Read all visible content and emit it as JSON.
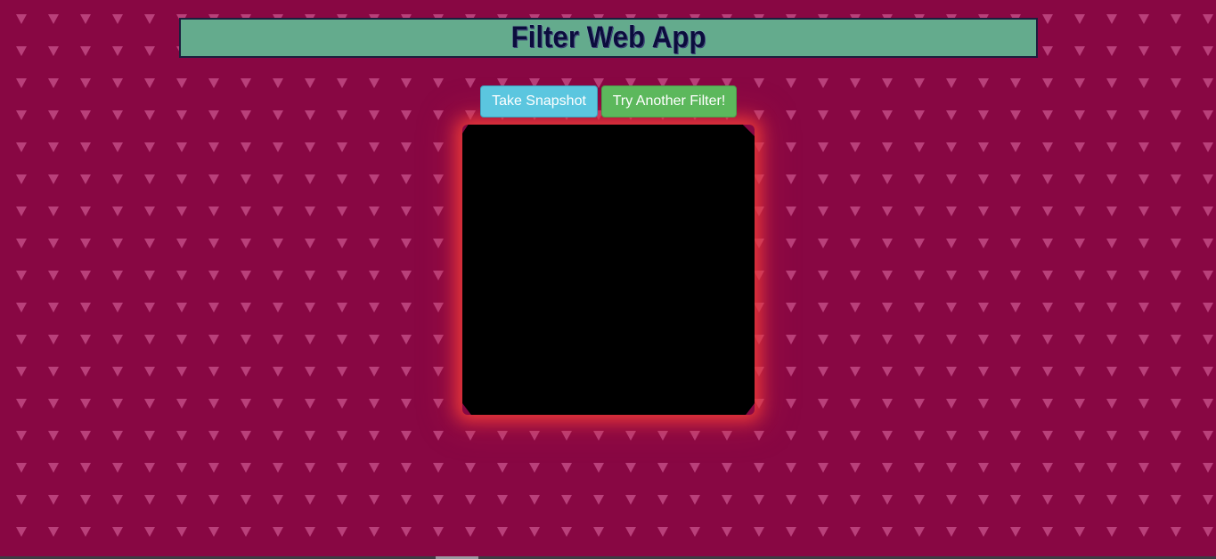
{
  "header": {
    "title": "Filter Web App"
  },
  "buttons": {
    "snapshot_label": "Take Snapshot",
    "filter_label": "Try Another Filter!"
  },
  "colors": {
    "background": "#880743",
    "pattern": "#c9538c",
    "header_bg": "#64ab8d",
    "title_text": "#0b0d3d",
    "snapshot_button": "#5bc6df",
    "filter_button": "#5cb85c",
    "video_glow": "#eb373c"
  }
}
